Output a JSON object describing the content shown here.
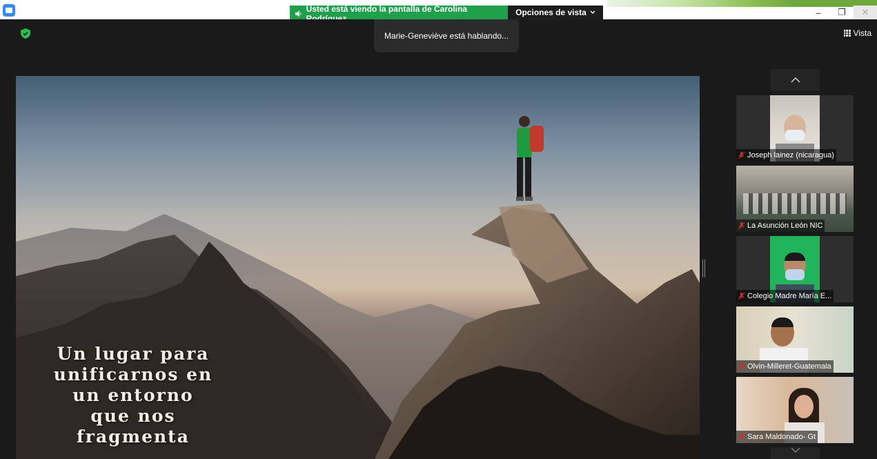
{
  "window": {
    "share_banner": "Usted está viendo la pantalla de Carolina Rodríguez",
    "view_options": "Opciones de vista",
    "minimize": "–",
    "restore": "❐",
    "close": "✕"
  },
  "meeting": {
    "speaking_toast": "Marie-Geneviève está hablando...",
    "view_label": "Vista"
  },
  "slide": {
    "lines": [
      "Un lugar para",
      "unificarnos en",
      "un entorno",
      "que nos",
      "fragmenta"
    ]
  },
  "gallery": {
    "up": "︿",
    "down": "﹀",
    "participants": [
      {
        "name": "Joseph lainez (nicaragua)",
        "muted": true
      },
      {
        "name": "La Asunción León NIC",
        "muted": true
      },
      {
        "name": "Colegio Madre María E...",
        "muted": true
      },
      {
        "name": "Olvin-Milleret-Guatemala",
        "muted": true
      },
      {
        "name": "Sara Maldonado- Gt",
        "muted": true
      }
    ]
  },
  "colors": {
    "share_green": "#1fa14b",
    "zoom_blue": "#2d8cff",
    "muted_red": "#e02828",
    "encryption_green": "#2dbd4e"
  }
}
